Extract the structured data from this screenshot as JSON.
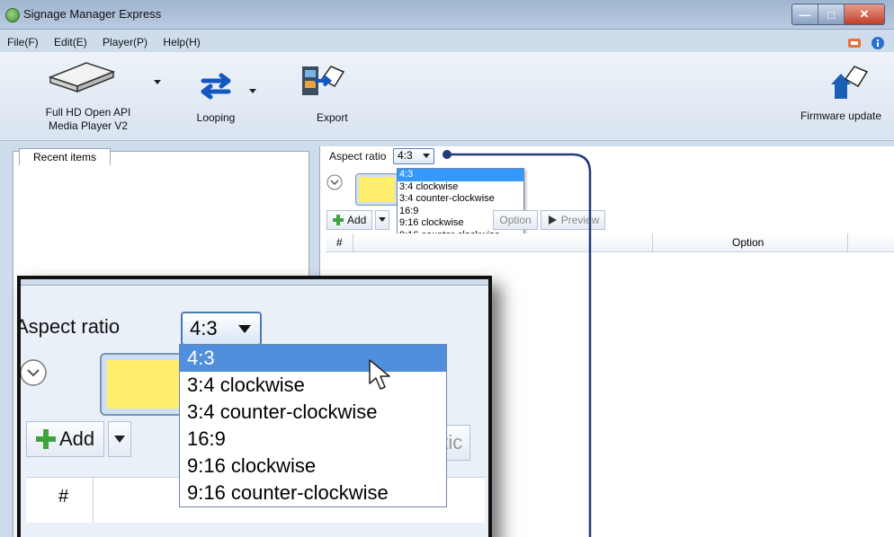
{
  "window": {
    "title": "Signage Manager Express"
  },
  "menu": [
    "File(F)",
    "Edit(E)",
    "Player(P)",
    "Help(H)"
  ],
  "ribbon": {
    "player_label_line1": "Full HD Open API",
    "player_label_line2": "Media Player V2",
    "looping_label": "Looping",
    "export_label": "Export",
    "firmware_label": "Firmware update"
  },
  "left_panel": {
    "tab_label": "Recent items"
  },
  "aspect": {
    "label": "Aspect ratio",
    "selected": "4:3",
    "options": [
      "4:3",
      "3:4 clockwise",
      "3:4 counter-clockwise",
      "16:9",
      "9:16 clockwise",
      "9:16 counter-clockwise"
    ]
  },
  "toolbar": {
    "add_label": "Add",
    "option_label": "Option",
    "preview_label": "Preview"
  },
  "grid": {
    "col_num": "#",
    "col_option": "Option"
  },
  "zoom": {
    "label": "Aspect ratio",
    "label_visible": "Aspect ratio",
    "selected": "4:3",
    "add_label": "Add",
    "option_fragment": "ptic",
    "col_num": "#"
  },
  "colors": {
    "callout": "#213a7a",
    "selection": "#3399ff",
    "swatch": "#ffed6b"
  }
}
